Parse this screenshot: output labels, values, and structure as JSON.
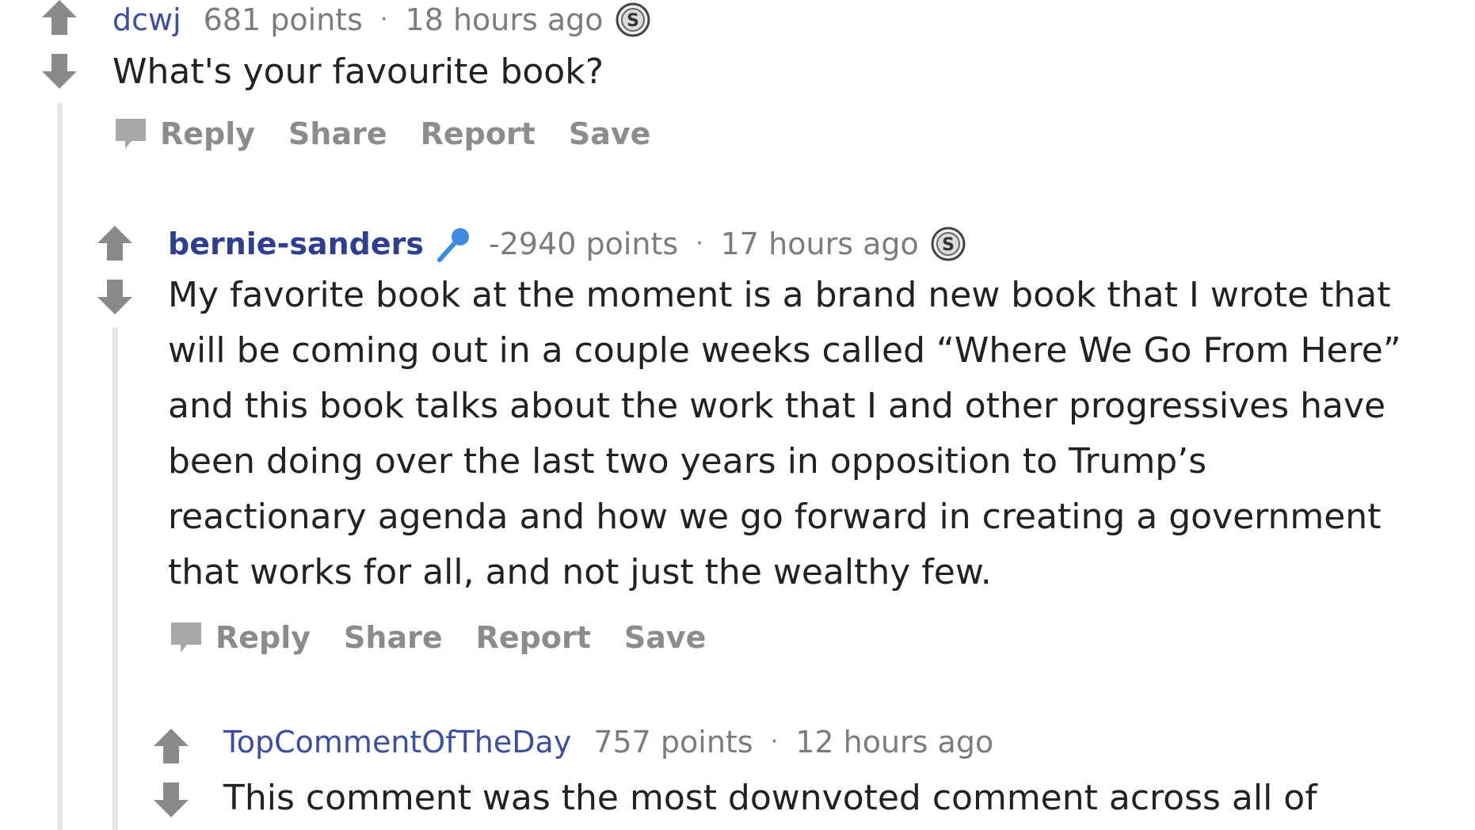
{
  "comments": [
    {
      "author": "dcwj",
      "points": "681 points",
      "separator": "·",
      "time": "18 hours ago",
      "body": "What's your favourite book?",
      "has_silver": true,
      "has_flair": false,
      "actions": [
        "Reply",
        "Share",
        "Report",
        "Save"
      ]
    },
    {
      "author": "bernie-sanders",
      "points": "-2940 points",
      "separator": "·",
      "time": "17 hours ago",
      "body": "My favorite book at the moment is a brand new book that I wrote that will be coming out in a couple weeks called “Where We Go From Here” and this book talks about the work that I and other progressives have been doing over the last two years in opposition to Trump’s reactionary agenda and how we go forward in creating a government that works for all, and not just the wealthy few.",
      "has_silver": true,
      "has_flair": true,
      "actions": [
        "Reply",
        "Share",
        "Report",
        "Save"
      ]
    },
    {
      "author": "TopCommentOfTheDay",
      "points": "757 points",
      "separator": "·",
      "time": "12 hours ago",
      "body": "This comment was the most downvoted comment across all of",
      "has_silver": false,
      "has_flair": false,
      "actions": []
    }
  ],
  "colors": {
    "author_link": "#3b4f9e",
    "meta_text": "#7c7c7c",
    "action_text": "#8c8c8c",
    "arrow": "#8a8a8a",
    "thread_line": "#e6e6e6",
    "flair_mic": "#3d8be0"
  },
  "icons": {
    "upvote": "upvote-arrow-icon",
    "downvote": "downvote-arrow-icon",
    "silver": "silver-award-icon",
    "flair": "microphone-icon",
    "reply": "comment-bubble-icon"
  }
}
